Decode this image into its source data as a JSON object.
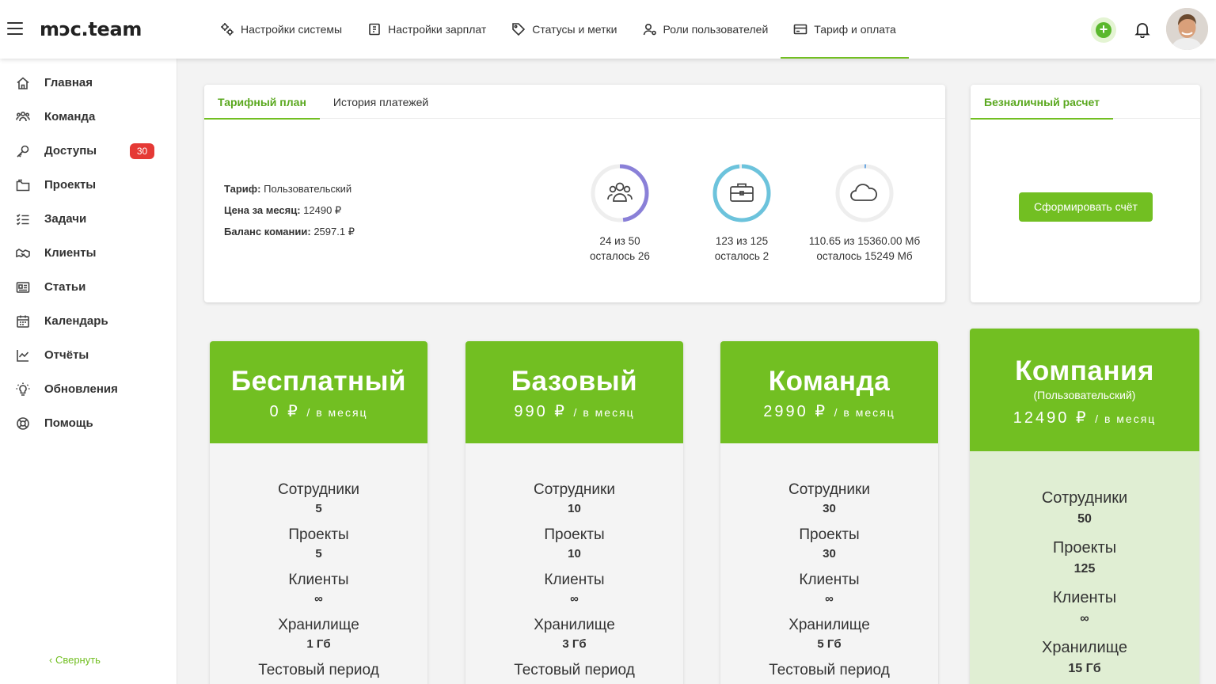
{
  "header": {
    "logo": "mɔc.team",
    "nav": [
      {
        "label": "Настройки системы",
        "icon": "settings-icon"
      },
      {
        "label": "Настройки зарплат",
        "icon": "salary-icon"
      },
      {
        "label": "Статусы и метки",
        "icon": "tag-icon"
      },
      {
        "label": "Роли пользователей",
        "icon": "user-roles-icon"
      },
      {
        "label": "Тариф и оплата",
        "icon": "credit-card-icon",
        "active": true
      }
    ]
  },
  "sidebar": {
    "items": [
      {
        "label": "Главная",
        "icon": "home-icon"
      },
      {
        "label": "Команда",
        "icon": "team-icon"
      },
      {
        "label": "Доступы",
        "icon": "key-icon",
        "badge": "30"
      },
      {
        "label": "Проекты",
        "icon": "folder-icon"
      },
      {
        "label": "Задачи",
        "icon": "tasks-icon"
      },
      {
        "label": "Клиенты",
        "icon": "handshake-icon"
      },
      {
        "label": "Статьи",
        "icon": "articles-icon"
      },
      {
        "label": "Календарь",
        "icon": "calendar-icon"
      },
      {
        "label": "Отчёты",
        "icon": "chart-icon"
      },
      {
        "label": "Обновления",
        "icon": "lightbulb-icon"
      },
      {
        "label": "Помощь",
        "icon": "help-icon"
      }
    ],
    "collapse_label": "‹ Свернуть"
  },
  "tariff_card": {
    "tabs": [
      "Тарифный план",
      "История платежей"
    ],
    "info": {
      "plan_label": "Тариф:",
      "plan_value": "Пользовательский",
      "price_label": "Цена за месяц:",
      "price_value": "12490 ₽",
      "balance_label": "Баланс комании:",
      "balance_value": "2597.1 ₽"
    },
    "usage": [
      {
        "icon": "users-icon",
        "line1": "24 из 50",
        "line2": "осталось 26",
        "fraction": 0.48,
        "color": "#8a80d8"
      },
      {
        "icon": "briefcase-icon",
        "line1": "123 из 125",
        "line2": "осталось 2",
        "fraction": 0.984,
        "color": "#6cc3dc"
      },
      {
        "icon": "cloud-icon",
        "line1": "110.65 из 15360.00 Мб",
        "line2": "осталось 15249 Мб",
        "fraction": 0.0072,
        "color": "#6aa6e0"
      }
    ]
  },
  "billing_card": {
    "tab": "Безналичный расчет",
    "button": "Сформировать счёт"
  },
  "plans": [
    {
      "name": "Бесплатный",
      "price": "0 ₽",
      "period": "/ в месяц",
      "features": [
        {
          "label": "Сотрудники",
          "value": "5"
        },
        {
          "label": "Проекты",
          "value": "5"
        },
        {
          "label": "Клиенты",
          "value": "∞"
        },
        {
          "label": "Хранилище",
          "value": "1 Гб"
        },
        {
          "label": "Тестовый период",
          "value": ""
        }
      ]
    },
    {
      "name": "Базовый",
      "price": "990 ₽",
      "period": "/ в месяц",
      "features": [
        {
          "label": "Сотрудники",
          "value": "10"
        },
        {
          "label": "Проекты",
          "value": "10"
        },
        {
          "label": "Клиенты",
          "value": "∞"
        },
        {
          "label": "Хранилище",
          "value": "3 Гб"
        },
        {
          "label": "Тестовый период",
          "value": ""
        }
      ]
    },
    {
      "name": "Команда",
      "price": "2990 ₽",
      "period": "/ в месяц",
      "features": [
        {
          "label": "Сотрудники",
          "value": "30"
        },
        {
          "label": "Проекты",
          "value": "30"
        },
        {
          "label": "Клиенты",
          "value": "∞"
        },
        {
          "label": "Хранилище",
          "value": "5 Гб"
        },
        {
          "label": "Тестовый период",
          "value": ""
        }
      ]
    },
    {
      "name": "Компания",
      "subtitle": "(Пользовательский)",
      "price": "12490 ₽",
      "period": "/ в месяц",
      "features": [
        {
          "label": "Сотрудники",
          "value": "50"
        },
        {
          "label": "Проекты",
          "value": "125"
        },
        {
          "label": "Клиенты",
          "value": "∞"
        },
        {
          "label": "Хранилище",
          "value": "15 Гб"
        }
      ]
    }
  ],
  "colors": {
    "accent": "#72bf22",
    "badge": "#e53935"
  }
}
